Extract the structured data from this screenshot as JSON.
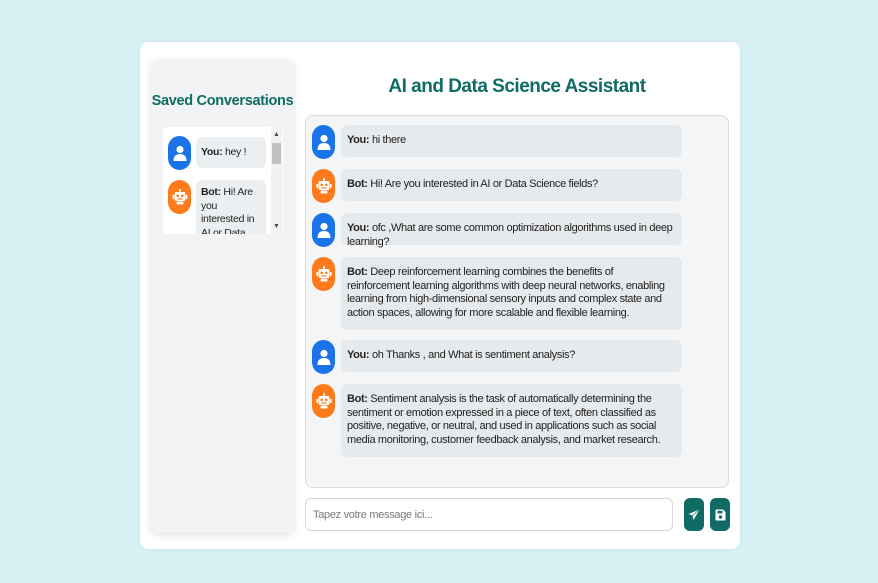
{
  "app": {
    "title": "AI and Data Science Assistant"
  },
  "sidebar": {
    "title": "Saved Conversations",
    "saved": [
      {
        "sender": "You:",
        "text": " hey !"
      },
      {
        "sender": "Bot:",
        "text": " Hi! Are you interested in AI or Data Science fields?"
      }
    ]
  },
  "chat": {
    "messages": [
      {
        "role": "user",
        "sender": "You:",
        "text": " hi there"
      },
      {
        "role": "bot",
        "sender": "Bot:",
        "text": " Hi! Are you interested in AI or Data Science fields?"
      },
      {
        "role": "user",
        "sender": "You:",
        "text": " ofc ,What are some common optimization algorithms used in deep learning?"
      },
      {
        "role": "bot",
        "sender": "Bot:",
        "text": " Deep reinforcement learning combines the benefits of reinforcement learning algorithms with deep neural networks, enabling learning from high-dimensional sensory inputs and complex state and action spaces, allowing for more scalable and flexible learning."
      },
      {
        "role": "user",
        "sender": "You:",
        "text": " oh Thanks , and What is sentiment analysis?"
      },
      {
        "role": "bot",
        "sender": "Bot:",
        "text": " Sentiment analysis is the task of automatically determining the sentiment or emotion expressed in a piece of text, often classified as positive, negative, or neutral, and used in applications such as social media monitoring, customer feedback analysis, and market research."
      }
    ]
  },
  "input": {
    "placeholder": "Tapez votre message ici..."
  },
  "icons": {
    "send": "send-icon",
    "save": "save-icon",
    "user_avatar": "user-icon",
    "bot_avatar": "robot-icon"
  },
  "colors": {
    "background": "#d8f1f5",
    "accent": "#0f6b63",
    "user_avatar": "#1a73e8",
    "bot_avatar": "#ff7a1a",
    "bubble": "#e7eaed"
  }
}
